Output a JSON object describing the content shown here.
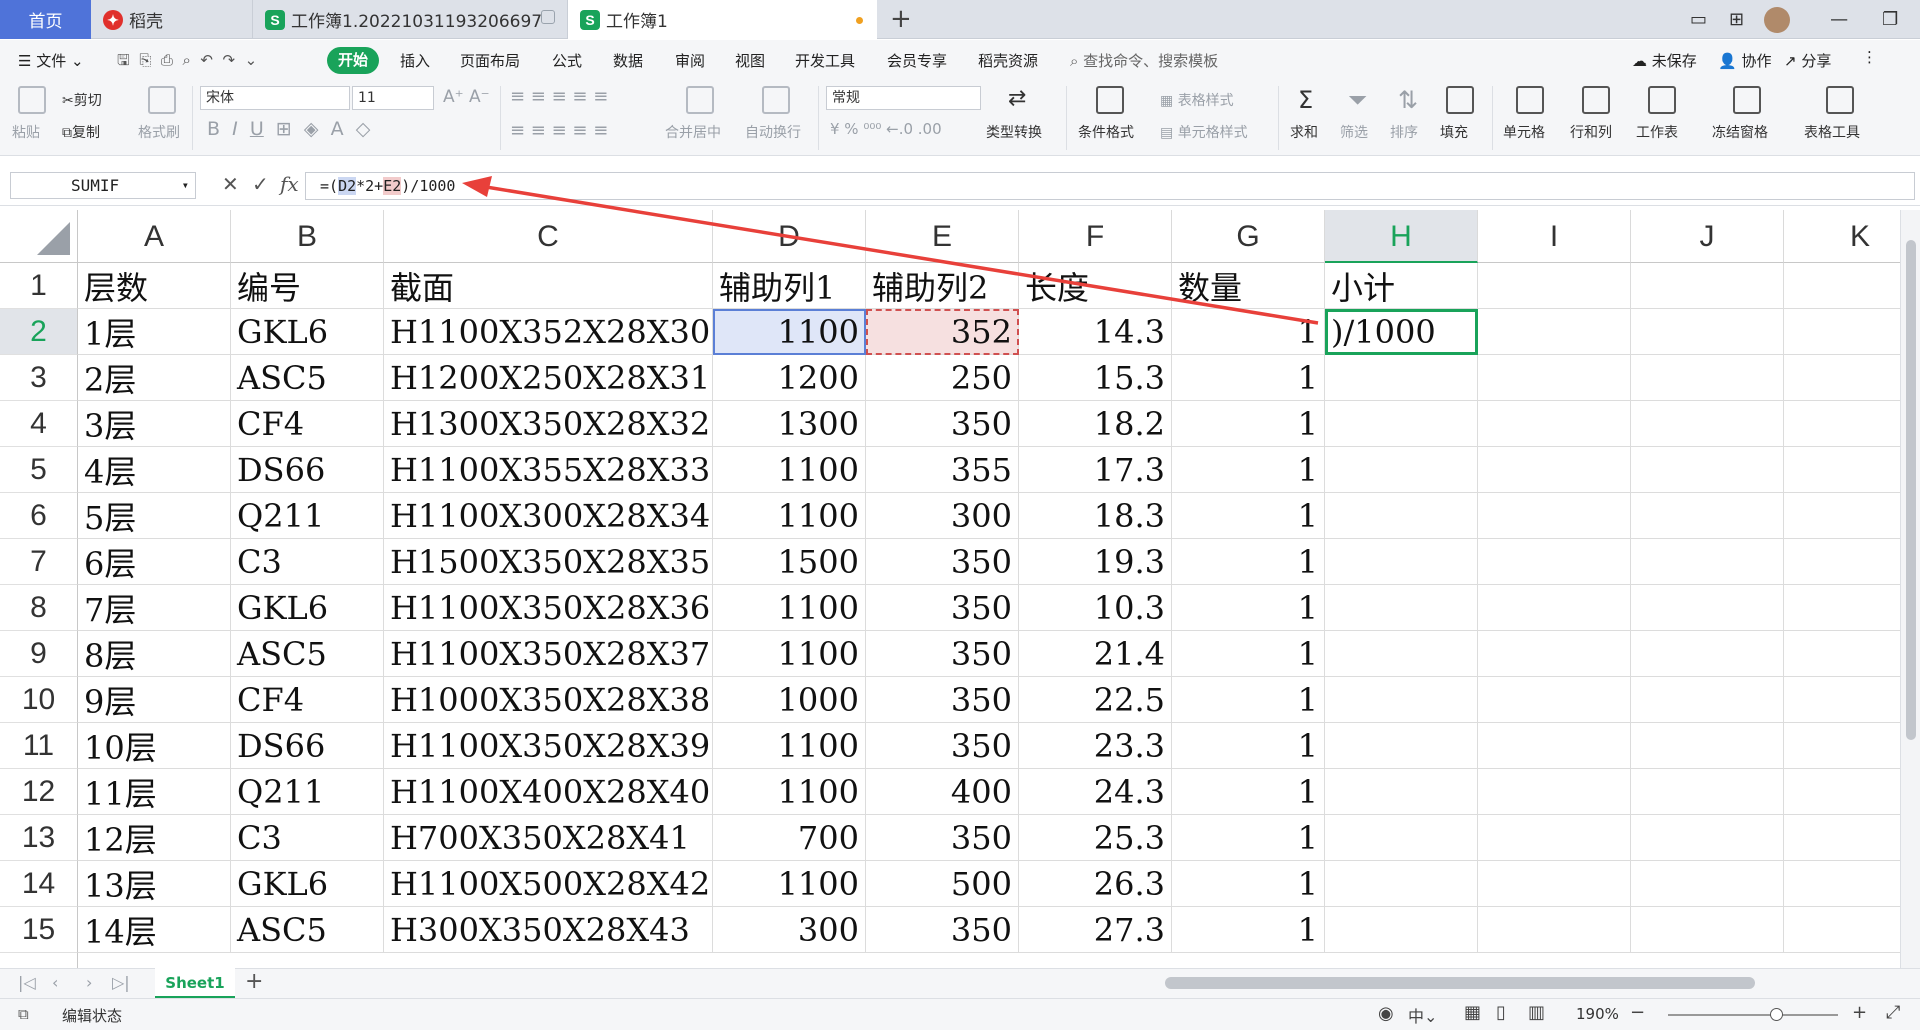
{
  "tabs": {
    "home": "首页",
    "docer": "稻壳",
    "file1": "工作簿1.20221031193206697",
    "file2": "工作簿1"
  },
  "menu": {
    "file": "文件",
    "start": "开始",
    "insert": "插入",
    "layout": "页面布局",
    "formula": "公式",
    "data": "数据",
    "review": "审阅",
    "view": "视图",
    "dev": "开发工具",
    "member": "会员专享",
    "docer_res": "稻壳资源",
    "search": "查找命令、搜索模板",
    "unsaved": "未保存",
    "collab": "协作",
    "share": "分享"
  },
  "ribbon": {
    "paste": "粘贴",
    "cut": "剪切",
    "copy": "复制",
    "format_painter": "格式刷",
    "font_name": "宋体",
    "font_size": "11",
    "merge": "合并居中",
    "wrap": "自动换行",
    "number_format": "常规",
    "type_convert": "类型转换",
    "cond_format": "条件格式",
    "table_style": "表格样式",
    "cell_style": "单元格样式",
    "sum": "求和",
    "filter": "筛选",
    "sort": "排序",
    "fill": "填充",
    "cell": "单元格",
    "row_col": "行和列",
    "sheet": "工作表",
    "freeze": "冻结窗格",
    "table_tools": "表格工具"
  },
  "formula_bar": {
    "name_box": "SUMIF",
    "fx": "fx",
    "f_pre": "=(",
    "f_d2": "D2",
    "f_mid": "*2+",
    "f_e2": "E2",
    "f_post": ")/1000"
  },
  "columns": [
    "A",
    "B",
    "C",
    "D",
    "E",
    "F",
    "G",
    "H",
    "I",
    "J",
    "K"
  ],
  "rows": [
    "1",
    "2",
    "3",
    "4",
    "5",
    "6",
    "7",
    "8",
    "9",
    "10",
    "11",
    "12",
    "13",
    "14",
    "15"
  ],
  "table": [
    [
      "层数",
      "编号",
      "截面",
      "辅助列1",
      "辅助列2",
      "长度",
      "数量",
      "小计"
    ],
    [
      "1层",
      "GKL6",
      "H1100X352X28X30",
      "1100",
      "352",
      "14.3",
      "1",
      ")/1000"
    ],
    [
      "2层",
      "ASC5",
      "H1200X250X28X31",
      "1200",
      "250",
      "15.3",
      "1",
      ""
    ],
    [
      "3层",
      "CF4",
      "H1300X350X28X32",
      "1300",
      "350",
      "18.2",
      "1",
      ""
    ],
    [
      "4层",
      "DS66",
      "H1100X355X28X33",
      "1100",
      "355",
      "17.3",
      "1",
      ""
    ],
    [
      "5层",
      "Q211",
      "H1100X300X28X34",
      "1100",
      "300",
      "18.3",
      "1",
      ""
    ],
    [
      "6层",
      "C3",
      "H1500X350X28X35",
      "1500",
      "350",
      "19.3",
      "1",
      ""
    ],
    [
      "7层",
      "GKL6",
      "H1100X350X28X36",
      "1100",
      "350",
      "10.3",
      "1",
      ""
    ],
    [
      "8层",
      "ASC5",
      "H1100X350X28X37",
      "1100",
      "350",
      "21.4",
      "1",
      ""
    ],
    [
      "9层",
      "CF4",
      "H1000X350X28X38",
      "1000",
      "350",
      "22.5",
      "1",
      ""
    ],
    [
      "10层",
      "DS66",
      "H1100X350X28X39",
      "1100",
      "350",
      "23.3",
      "1",
      ""
    ],
    [
      "11层",
      "Q211",
      "H1100X400X28X40",
      "1100",
      "400",
      "24.3",
      "1",
      ""
    ],
    [
      "12层",
      "C3",
      "H700X350X28X41",
      "700",
      "350",
      "25.3",
      "1",
      ""
    ],
    [
      "13层",
      "GKL6",
      "H1100X500X28X42",
      "1100",
      "500",
      "26.3",
      "1",
      ""
    ],
    [
      "14层",
      "ASC5",
      "H300X350X28X43",
      "300",
      "350",
      "27.3",
      "1",
      ""
    ]
  ],
  "sheet_tab": "Sheet1",
  "status": {
    "mode": "编辑状态",
    "zoom": "190%"
  },
  "colors": {
    "accent": "#19a35a",
    "home_tab": "#4f73d9",
    "arrow": "#e8403a"
  }
}
